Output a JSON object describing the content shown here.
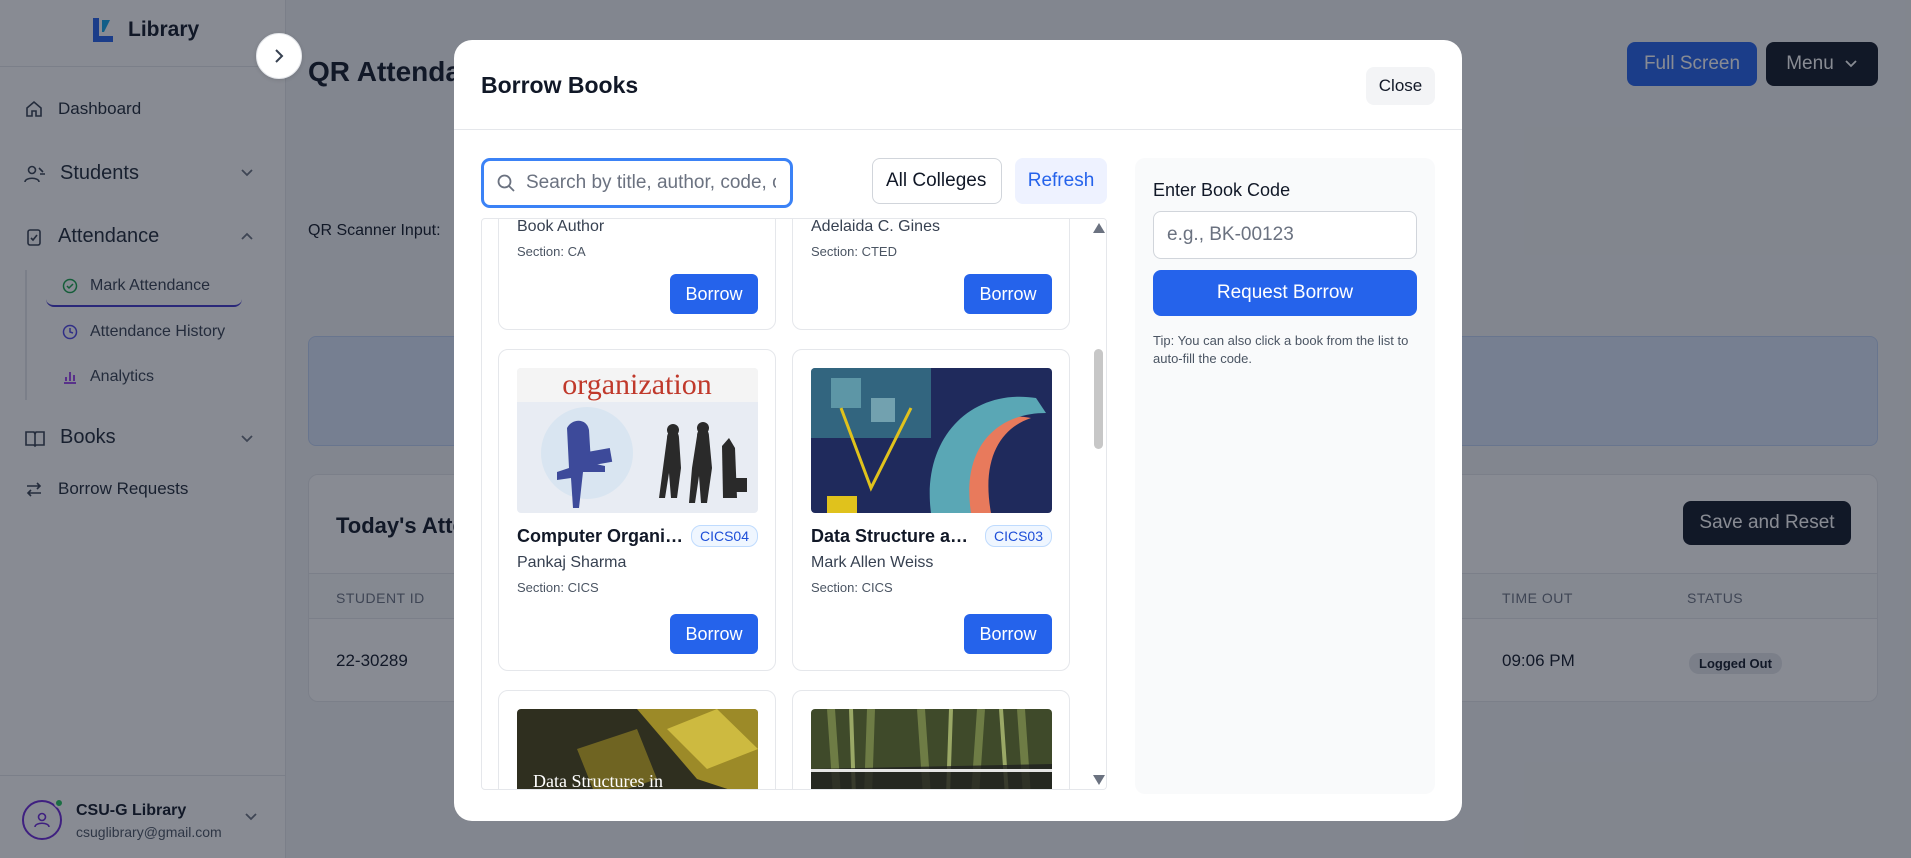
{
  "app": {
    "brand": "Library",
    "page_title": "QR Attendance"
  },
  "sidebar": {
    "items": [
      {
        "label": "Dashboard"
      },
      {
        "label": "Students"
      },
      {
        "label": "Attendance"
      },
      {
        "label": "Books"
      },
      {
        "label": "Borrow Requests"
      }
    ],
    "attendance_sub": [
      {
        "label": "Mark Attendance"
      },
      {
        "label": "Attendance History"
      },
      {
        "label": "Analytics"
      }
    ],
    "profile": {
      "name": "CSU-G Library",
      "email": "csuglibrary@gmail.com"
    }
  },
  "header": {
    "full_screen": "Full Screen",
    "menu": "Menu"
  },
  "main": {
    "qr_label": "QR Scanner Input:",
    "attendance_title": "Today's Attendance",
    "save_reset": "Save and Reset",
    "columns": [
      "STUDENT ID",
      "TIME OUT",
      "STATUS"
    ],
    "row": {
      "student_id": "22-30289",
      "time_out": "09:06 PM",
      "status": "Logged Out"
    }
  },
  "modal": {
    "title": "Borrow Books",
    "close": "Close",
    "search_placeholder": "Search by title, author, code, or section",
    "college_filter": "All Colleges",
    "refresh": "Refresh",
    "books": [
      {
        "title": "",
        "author": "Book Author",
        "section": "Section: CA",
        "code": "",
        "borrow": "Borrow"
      },
      {
        "title": "",
        "author": "Adelaida C. Gines",
        "section": "Section: CTED",
        "code": "",
        "borrow": "Borrow"
      },
      {
        "title": "Computer Organization",
        "author": "Pankaj Sharma",
        "section": "Section: CICS",
        "code": "CICS04",
        "borrow": "Borrow",
        "cover_text": "organization"
      },
      {
        "title": "Data Structure and Algorithm",
        "author": "Mark Allen Weiss",
        "section": "Section: CICS",
        "code": "CICS03",
        "borrow": "Borrow"
      },
      {
        "title": "",
        "author": "",
        "section": "",
        "code": "",
        "cover_text": "Data Structures in"
      },
      {
        "title": "",
        "author": "",
        "section": "",
        "code": ""
      }
    ],
    "code_panel": {
      "label": "Enter Book Code",
      "placeholder": "e.g., BK-00123",
      "request": "Request Borrow",
      "tip": "Tip: You can also click a book from the list to auto-fill the code."
    }
  },
  "colors": {
    "accent": "#2563eb",
    "dark": "#111827"
  }
}
